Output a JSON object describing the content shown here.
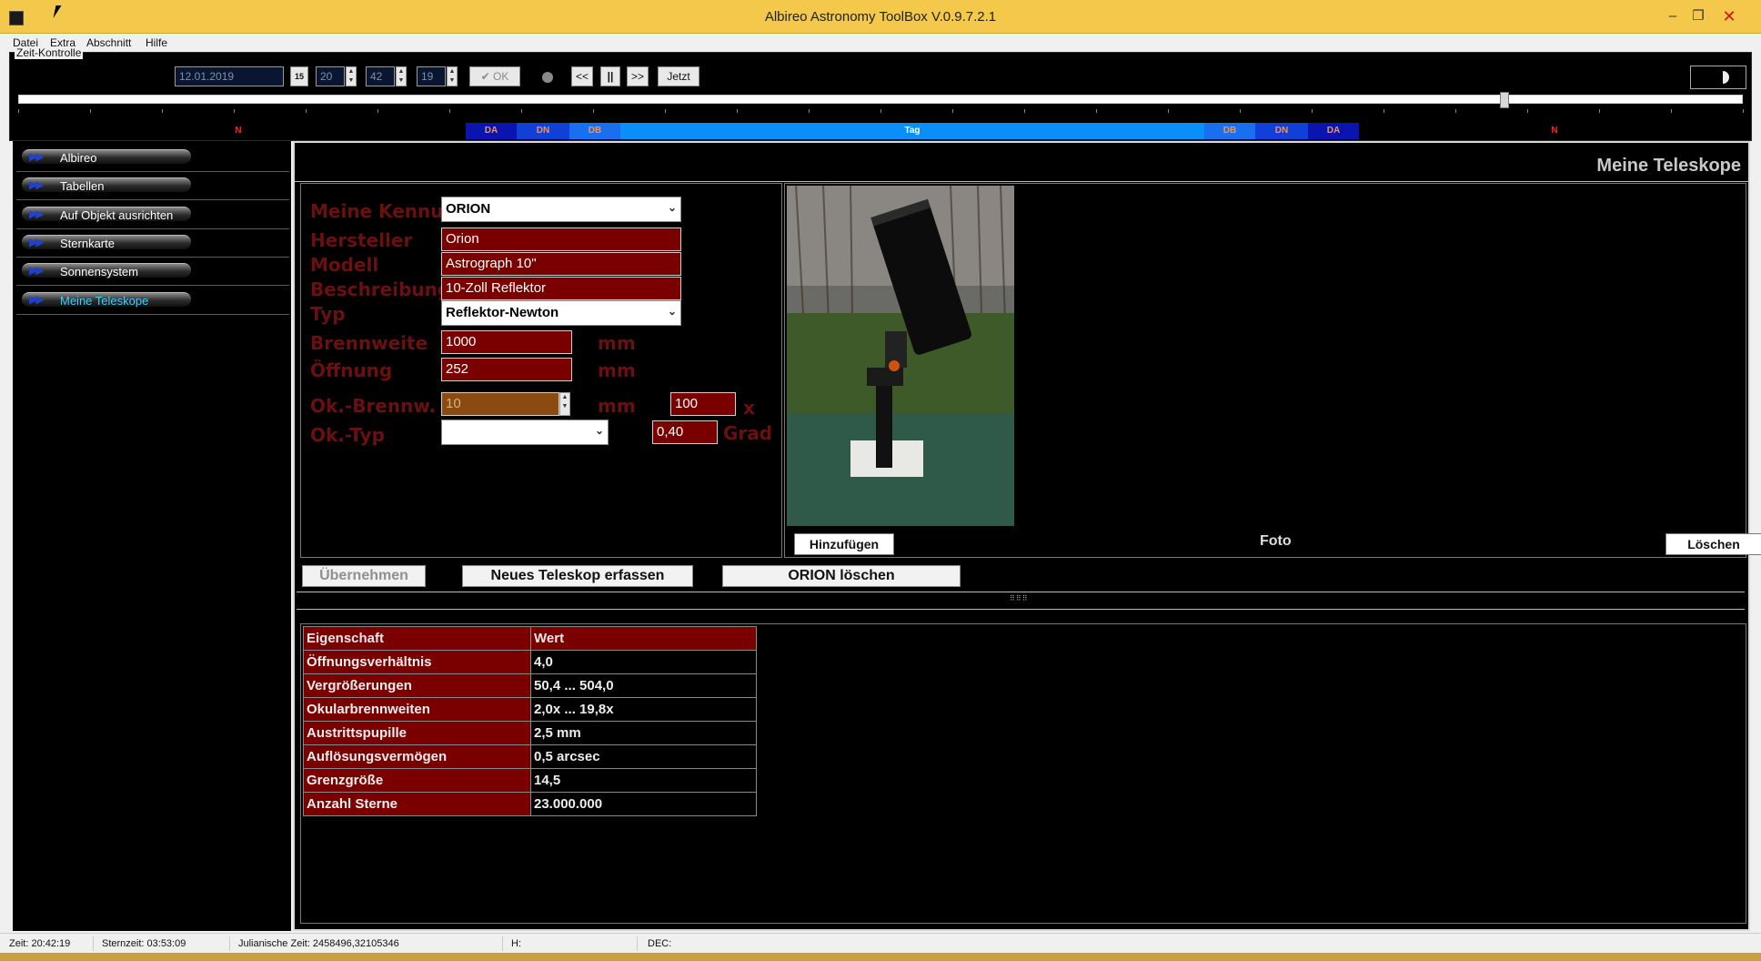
{
  "window": {
    "title": "Albireo Astronomy ToolBox V.0.9.7.2.1",
    "min": "–",
    "max": "❐",
    "close": "✕"
  },
  "menu": [
    "Datei",
    "Extra",
    "Abschnitt",
    "Hilfe"
  ],
  "time_control": {
    "legend": "Zeit-Kontrolle",
    "date": "12.01.2019",
    "calendar_icon": "15",
    "hour": "20",
    "minute": "42",
    "second": "19",
    "ok_label": "✔ OK",
    "rewind_label": "<<",
    "pause_label": "||",
    "forward_label": ">>",
    "now_label": "Jetzt",
    "slider_position": 0.862
  },
  "timeline": [
    {
      "label": "N",
      "color": "#ff2020"
    },
    {
      "label": "DA",
      "color": "#ff9040"
    },
    {
      "label": "DN",
      "color": "#ff9040"
    },
    {
      "label": "DB",
      "color": "#ff9040"
    },
    {
      "label": "Tag",
      "color": "#ffffff"
    },
    {
      "label": "DB",
      "color": "#ff9040"
    },
    {
      "label": "DN",
      "color": "#ff9040"
    },
    {
      "label": "DA",
      "color": "#ff9040"
    },
    {
      "label": "N",
      "color": "#ff2020"
    }
  ],
  "nav": {
    "items": [
      {
        "label": "Albireo"
      },
      {
        "label": "Tabellen"
      },
      {
        "label": "Auf Objekt ausrichten"
      },
      {
        "label": "Sternkarte"
      },
      {
        "label": "Sonnensystem"
      },
      {
        "label": "Meine Teleskope"
      }
    ],
    "arrows": "▶▶"
  },
  "main": {
    "title": "Meine Teleskope",
    "form": {
      "kennung_label": "Meine Kennung",
      "kennung_value": "ORION",
      "hersteller_label": "Hersteller",
      "hersteller_value": "Orion",
      "modell_label": "Modell",
      "modell_value": "Astrograph 10\"",
      "beschreibung_label": "Beschreibung",
      "beschreibung_value": "10-Zoll Reflektor",
      "typ_label": "Typ",
      "typ_value": "Reflektor-Newton",
      "brennweite_label": "Brennweite",
      "brennweite_value": "1000",
      "brennweite_unit": "mm",
      "oeffnung_label": "Öffnung",
      "oeffnung_value": "252",
      "oeffnung_unit": "mm",
      "okbrennw_label": "Ok.-Brennw.",
      "okbrennw_value": "10",
      "okbrennw_unit": "mm",
      "vergroesserung_value": "100",
      "vergroesserung_unit": "x",
      "oktyp_label": "Ok.-Typ",
      "oktyp_value": "",
      "feld_value": "0,40",
      "feld_unit": "Grad"
    },
    "photo": {
      "add_label": "Hinzufügen",
      "caption": "Foto",
      "delete_label": "Löschen"
    },
    "actions": {
      "apply_label": "Übernehmen",
      "new_label": "Neues Teleskop erfassen",
      "delete_label": "ORION löschen"
    },
    "table": {
      "headers": [
        "Eigenschaft",
        "Wert"
      ],
      "rows": [
        [
          "Öffnungsverhältnis",
          "4,0"
        ],
        [
          "Vergrößerungen",
          "50,4 ... 504,0"
        ],
        [
          "Okularbrennweiten",
          "2,0x ... 19,8x"
        ],
        [
          "Austrittspupille",
          "2,5 mm"
        ],
        [
          "Auflösungsvermögen",
          "0,5 arcsec"
        ],
        [
          "Grenzgröße",
          "14,5"
        ],
        [
          "Anzahl Sterne",
          "23.000.000"
        ]
      ]
    }
  },
  "status": {
    "zeit": "Zeit: 20:42:19",
    "sternzeit": "Sternzeit: 03:53:09",
    "julian": "Julianische Zeit: 2458496,32105346",
    "h": "H:",
    "dec": "DEC:"
  }
}
